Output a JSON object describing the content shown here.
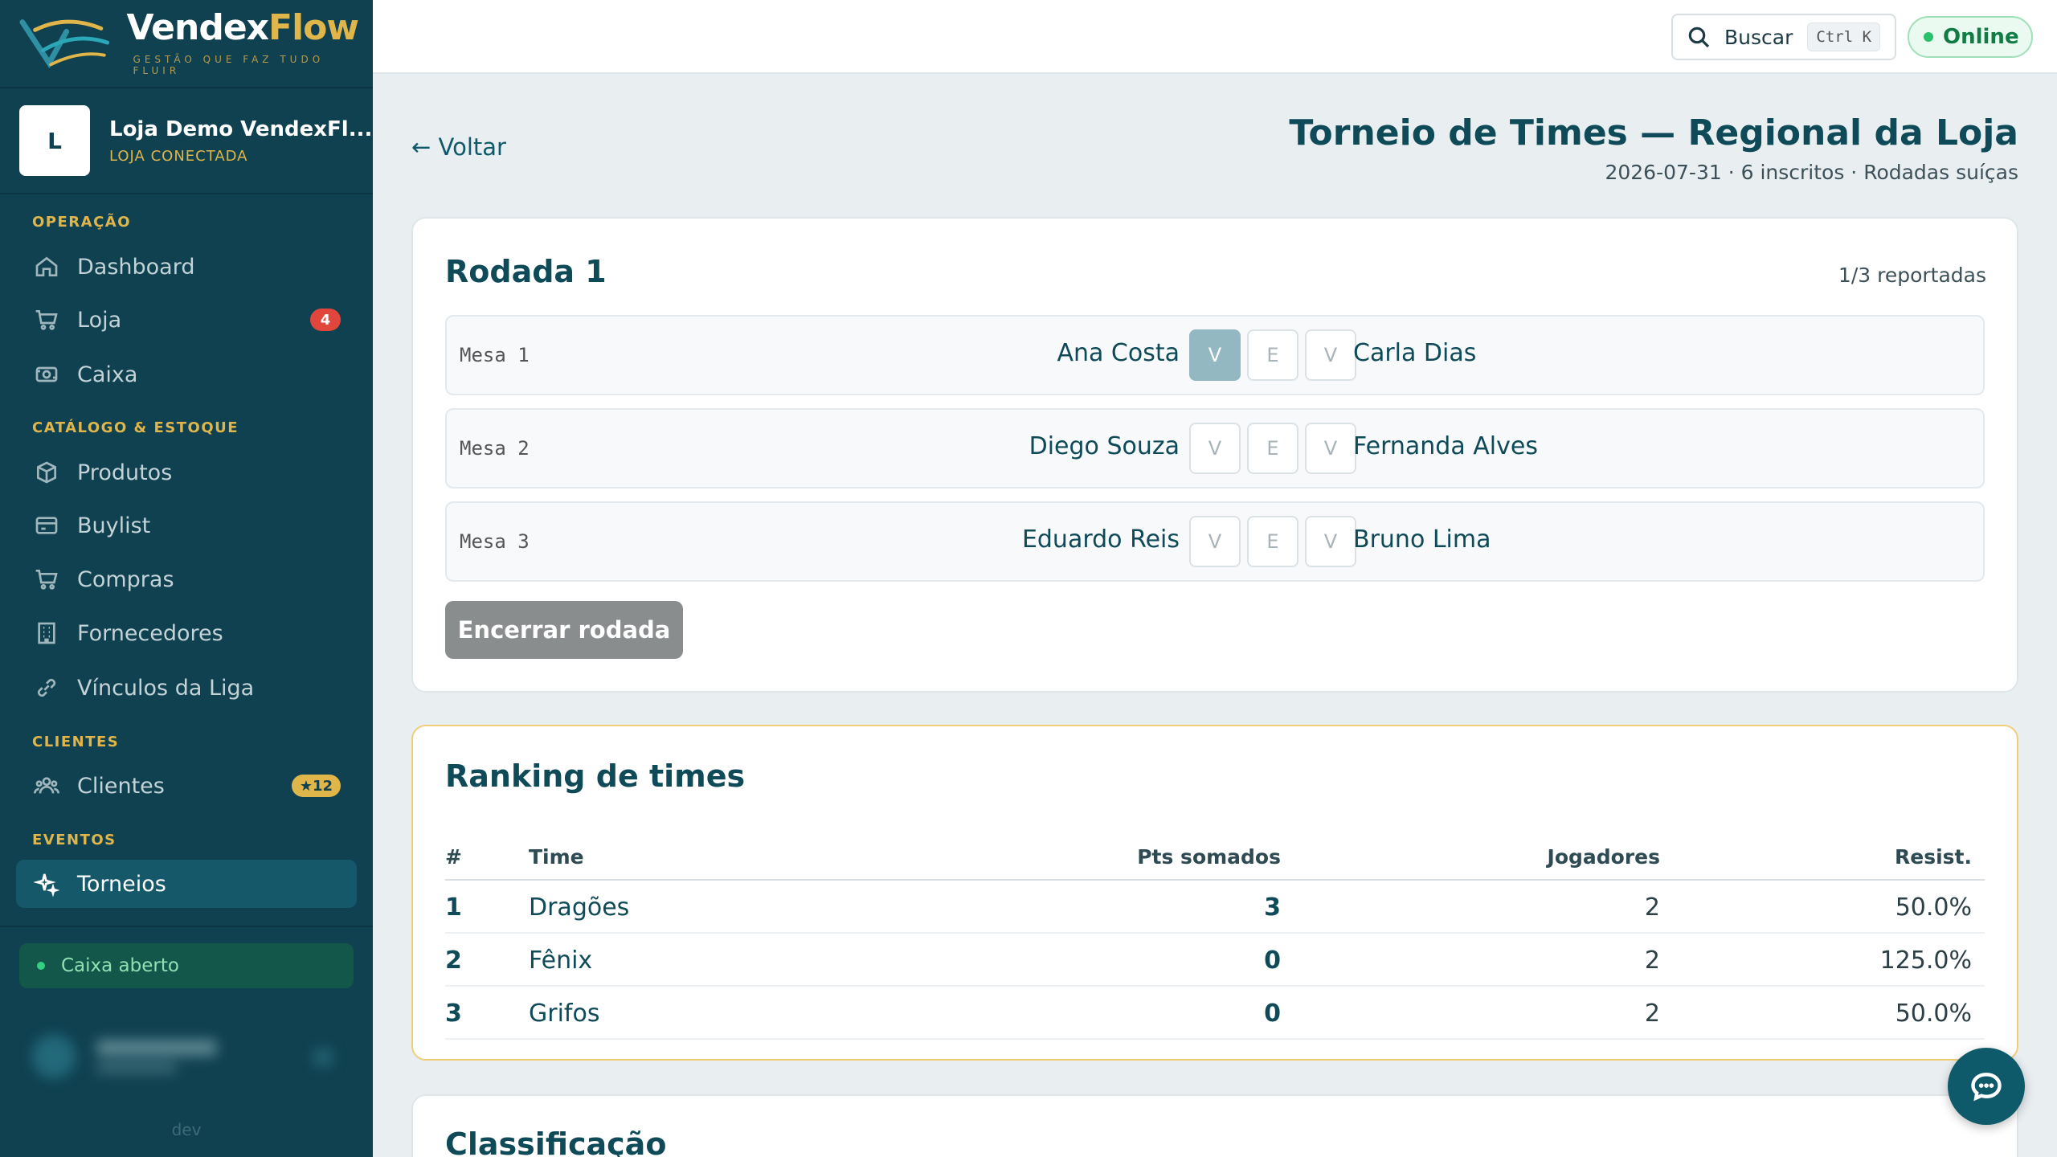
{
  "brand": {
    "name_a": "Vendex",
    "name_b": "Flow",
    "tagline": "GESTÃO QUE FAZ TUDO FLUIR"
  },
  "store": {
    "avatar_letter": "L",
    "name": "Loja Demo VendexFl...",
    "status": "LOJA CONECTADA"
  },
  "sidebar": {
    "sections": {
      "operacao": "OPERAÇÃO",
      "catalogo": "CATÁLOGO & ESTOQUE",
      "clientes": "CLIENTES",
      "eventos": "EVENTOS"
    },
    "items": {
      "dashboard": {
        "label": "Dashboard",
        "icon": "home-icon"
      },
      "loja": {
        "label": "Loja",
        "icon": "cart-icon",
        "badge": "4"
      },
      "caixa": {
        "label": "Caixa",
        "icon": "cash-icon"
      },
      "produtos": {
        "label": "Produtos",
        "icon": "box-icon"
      },
      "buylist": {
        "label": "Buylist",
        "icon": "card-icon"
      },
      "compras": {
        "label": "Compras",
        "icon": "cart-icon"
      },
      "fornecedores": {
        "label": "Fornecedores",
        "icon": "building-icon"
      },
      "vinculos": {
        "label": "Vínculos da Liga",
        "icon": "link-icon"
      },
      "clientes": {
        "label": "Clientes",
        "icon": "users-icon",
        "badge": "★12"
      },
      "torneios": {
        "label": "Torneios",
        "icon": "sparkle-icon",
        "active": true
      }
    },
    "cash_status": "Caixa aberto",
    "env": "dev"
  },
  "topbar": {
    "search_label": "Buscar",
    "search_shortcut": "Ctrl K",
    "status": "Online"
  },
  "page": {
    "back_label": "← Voltar",
    "title": "Torneio de Times — Regional da Loja",
    "subtitle": "2026-07-31 · 6 inscritos · Rodadas suíças"
  },
  "round": {
    "title": "Rodada 1",
    "reported": "1/3 reportadas",
    "result_labels": [
      "V",
      "E",
      "V"
    ],
    "matches": [
      {
        "table": "Mesa 1",
        "player1": "Ana Costa",
        "player2": "Carla Dias",
        "selected": 0
      },
      {
        "table": "Mesa 2",
        "player1": "Diego Souza",
        "player2": "Fernanda Alves",
        "selected": null
      },
      {
        "table": "Mesa 3",
        "player1": "Eduardo Reis",
        "player2": "Bruno Lima",
        "selected": null
      }
    ],
    "end_button": "Encerrar rodada"
  },
  "ranking": {
    "title": "Ranking de times",
    "columns": [
      "#",
      "Time",
      "Pts somados",
      "Jogadores",
      "Resist."
    ],
    "rows": [
      {
        "pos": "1",
        "team": "Dragões",
        "pts": "3",
        "players": "2",
        "resist": "50.0%"
      },
      {
        "pos": "2",
        "team": "Fênix",
        "pts": "0",
        "players": "2",
        "resist": "125.0%"
      },
      {
        "pos": "3",
        "team": "Grifos",
        "pts": "0",
        "players": "2",
        "resist": "50.0%"
      }
    ]
  },
  "classificacao": {
    "title": "Classificação"
  },
  "colors": {
    "sidebar_bg": "#0f4150",
    "accent_gold": "#e0b54a",
    "primary": "#0e4a57",
    "online_green": "#28c26a",
    "badge_red": "#e0463c"
  }
}
